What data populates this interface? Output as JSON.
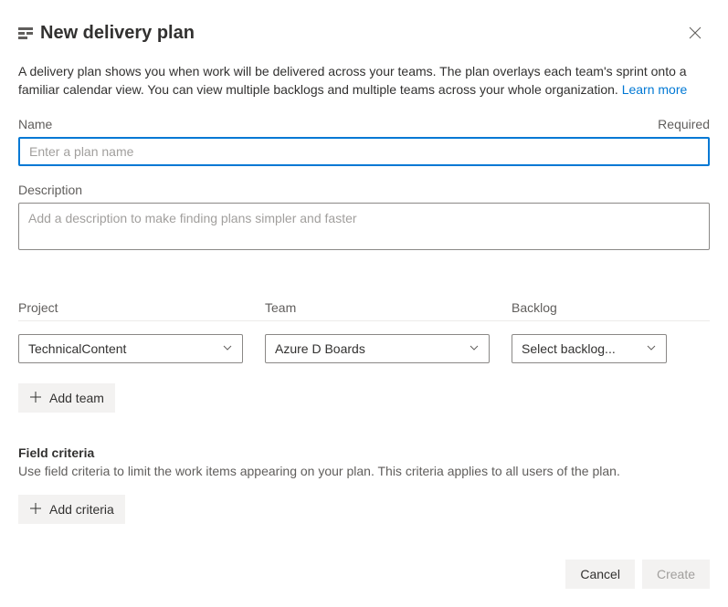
{
  "header": {
    "title": "New delivery plan"
  },
  "intro": {
    "text": "A delivery plan shows you when work will be delivered across your teams. The plan overlays each team's sprint onto a familiar calendar view. You can view multiple backlogs and multiple teams across your whole organization. ",
    "learn_more": "Learn more"
  },
  "name_field": {
    "label": "Name",
    "required": "Required",
    "placeholder": "Enter a plan name"
  },
  "description_field": {
    "label": "Description",
    "placeholder": "Add a description to make finding plans simpler and faster"
  },
  "columns": {
    "project": "Project",
    "team": "Team",
    "backlog": "Backlog"
  },
  "row": {
    "project": "TechnicalContent",
    "team": "Azure D Boards",
    "backlog": "Select backlog..."
  },
  "add_team_label": "Add team",
  "field_criteria": {
    "title": "Field criteria",
    "desc": "Use field criteria to limit the work items appearing on your plan. This criteria applies to all users of the plan.",
    "add_label": "Add criteria"
  },
  "footer": {
    "cancel": "Cancel",
    "create": "Create"
  }
}
